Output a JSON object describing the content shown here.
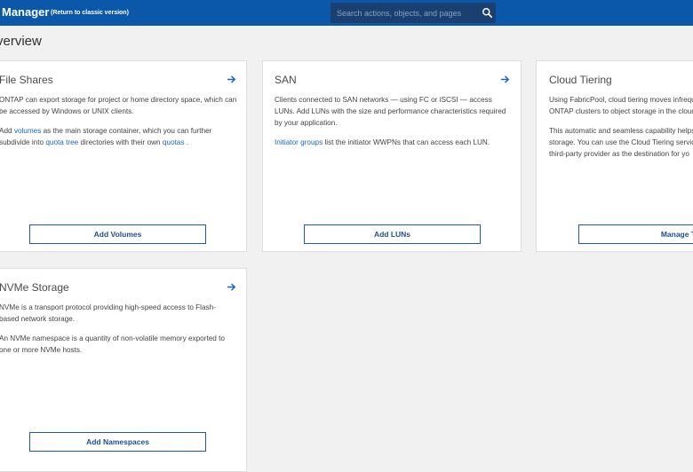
{
  "header": {
    "app_title": "Manager",
    "return_link": "(Return to classic version)",
    "search_placeholder": "Search actions, objects, and pages",
    "search_icon": "search-icon"
  },
  "page": {
    "title": "verview"
  },
  "cards": {
    "file_shares": {
      "title": "File Shares",
      "p1": "ONTAP can export storage for project or home directory space, which can be accessed by Windows or UNIX clients.",
      "p2_pre": "Add ",
      "p2_link1": "volumes",
      "p2_mid1": " as the main storage container, which you can further subdivide into ",
      "p2_link2": "quota tree",
      "p2_mid2": " directories with their own ",
      "p2_link3": "quotas",
      "p2_post": " .",
      "button": "Add Volumes"
    },
    "san": {
      "title": "SAN",
      "p1": "Clients connected to SAN networks — using FC or iSCSI — access LUNs. Add LUNs with the size and performance characteristics required by your application.",
      "p2_link": "Initiator groups",
      "p2_post": " list the initiator WWPNs that can access each LUN.",
      "button": "Add LUNs"
    },
    "cloud_tiering": {
      "title": "Cloud Tiering",
      "p1": "Using FabricPool, cloud tiering moves infrequ ONTAP clusters to object storage in the cloud.",
      "p2": "This automatic and seamless capability helps storage.  You can use the Cloud Tiering servic third-party provider as the destination for yo",
      "button": "Manage Tiers"
    },
    "nvme": {
      "title": "NVMe Storage",
      "p1": "NVMe is a transport protocol providing high-speed access to Flash-based network storage.",
      "p2": "An NVMe namespace is a quantity of non-volatile memory exported to one or more NVMe hosts.",
      "button": "Add Namespaces"
    }
  },
  "colors": {
    "header_bg": "#0b57a9",
    "search_bg": "#1a3f71",
    "link": "#1a66c4",
    "button_border": "#1e5aa8",
    "page_bg": "#f1f1f1"
  },
  "icons": {
    "card_arrow": "arrow-right-icon"
  }
}
